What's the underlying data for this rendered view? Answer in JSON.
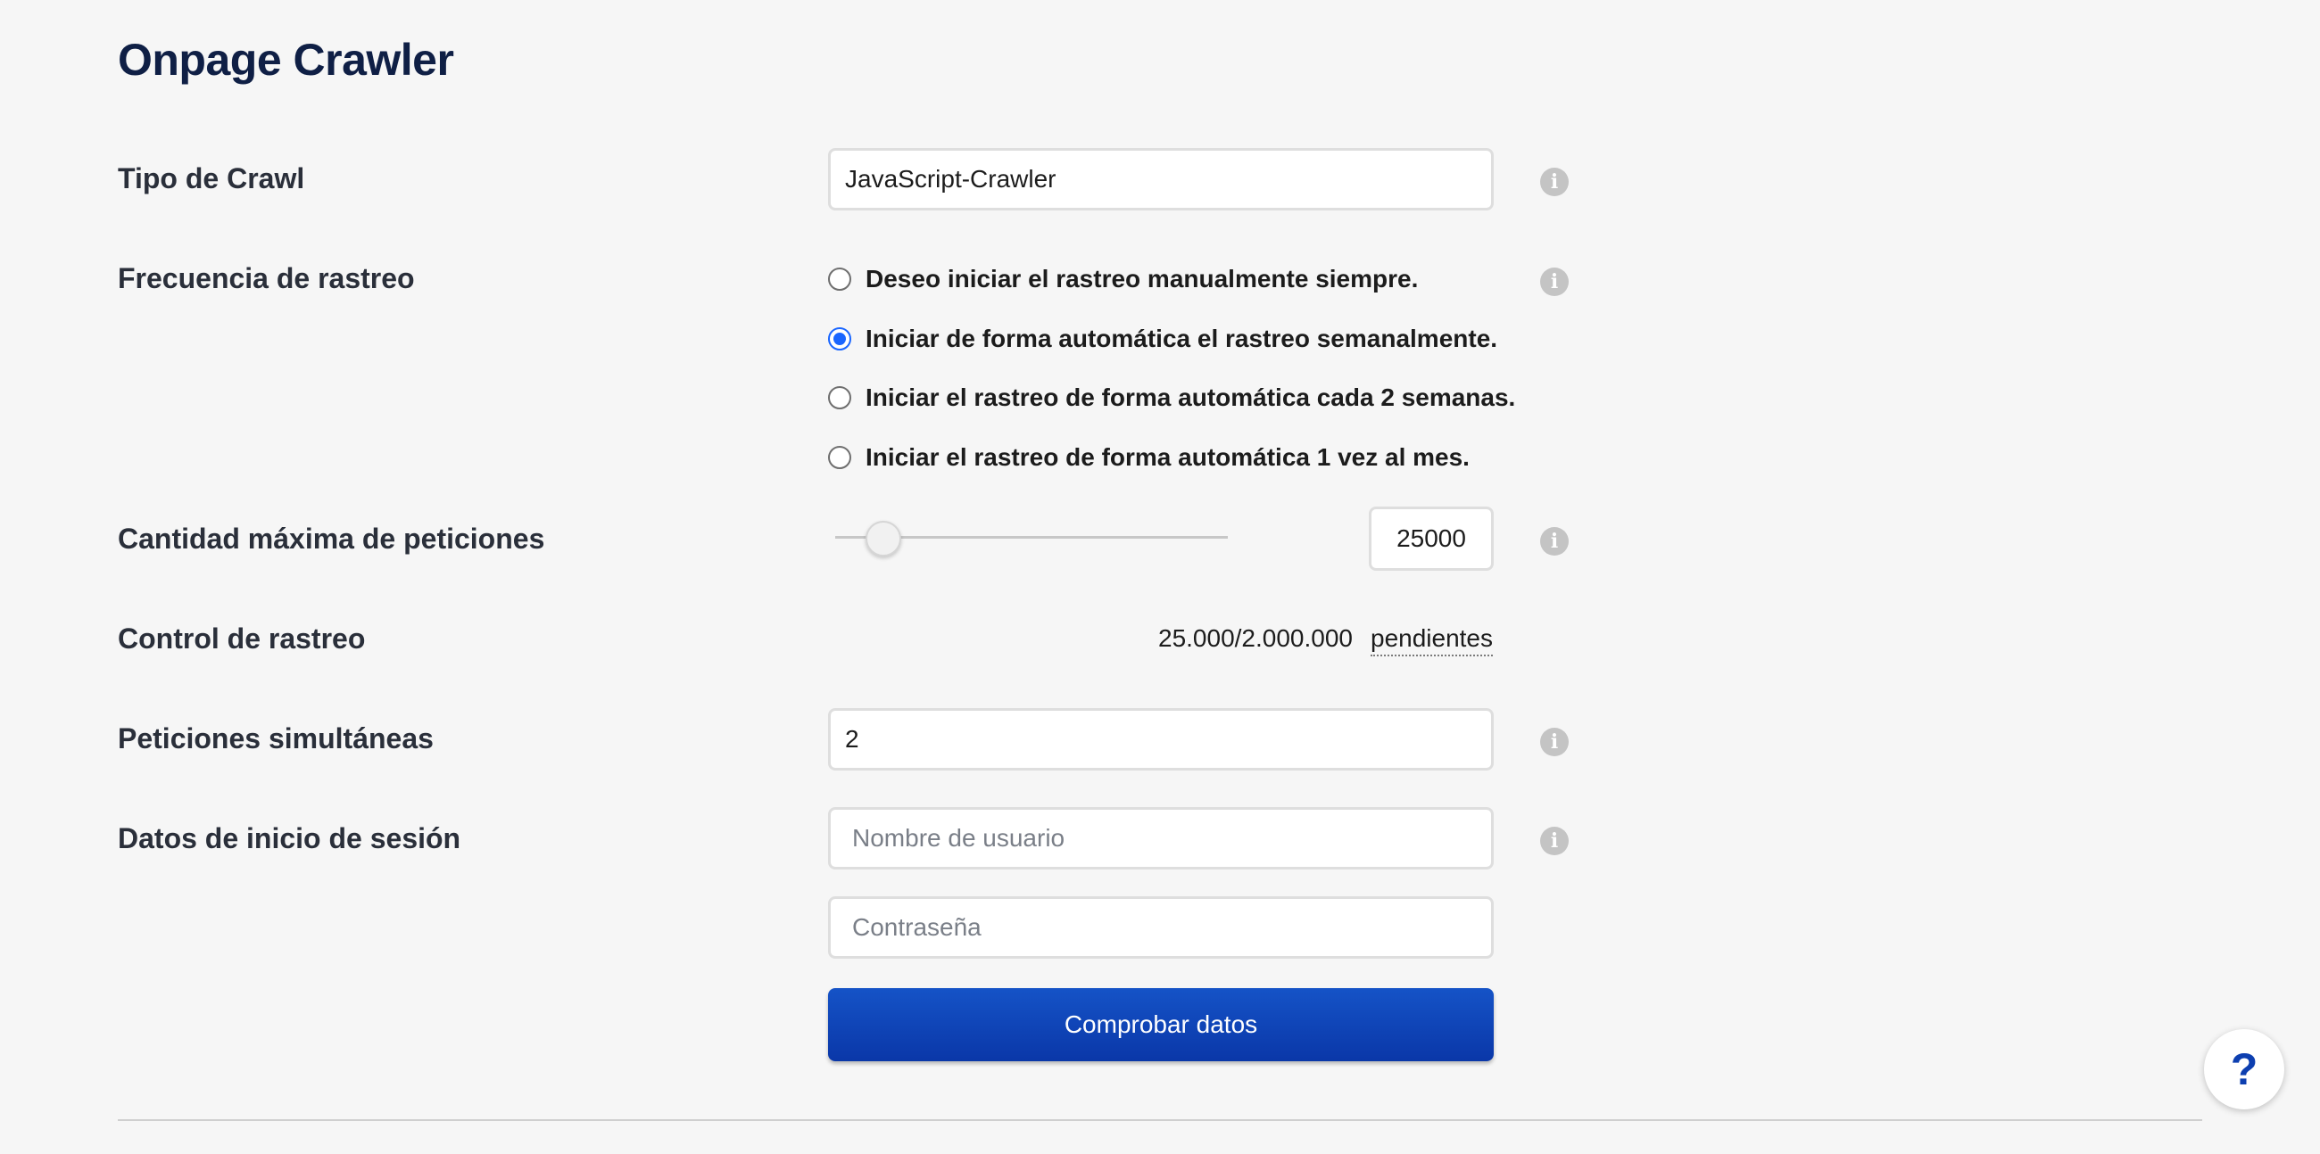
{
  "page": {
    "title": "Onpage Crawler"
  },
  "crawl_type": {
    "label": "Tipo de Crawl",
    "value": "JavaScript-Crawler"
  },
  "frequency": {
    "label": "Frecuencia de rastreo",
    "options": [
      {
        "label": "Deseo iniciar el rastreo manualmente siempre.",
        "checked": false
      },
      {
        "label": "Iniciar de forma automática el rastreo semanalmente.",
        "checked": true
      },
      {
        "label": "Iniciar el rastreo de forma automática cada 2 semanas.",
        "checked": false
      },
      {
        "label": "Iniciar el rastreo de forma automática 1 vez al mes.",
        "checked": false
      }
    ]
  },
  "max_requests": {
    "label": "Cantidad máxima de peticiones",
    "value": "25000"
  },
  "crawl_control": {
    "label": "Control de rastreo",
    "quota": "25.000/2.000.000",
    "pending": "pendientes"
  },
  "simultaneous": {
    "label": "Peticiones simultáneas",
    "value": "2"
  },
  "login": {
    "label": "Datos de inicio de sesión",
    "username_placeholder": "Nombre de usuario",
    "password_placeholder": "Contraseña",
    "check_button": "Comprobar datos"
  },
  "help": {
    "symbol": "?"
  },
  "icons": {
    "info": "info-icon"
  },
  "colors": {
    "accent": "#1a66ff",
    "button": "#0d45b8",
    "title": "#0f1f45"
  }
}
